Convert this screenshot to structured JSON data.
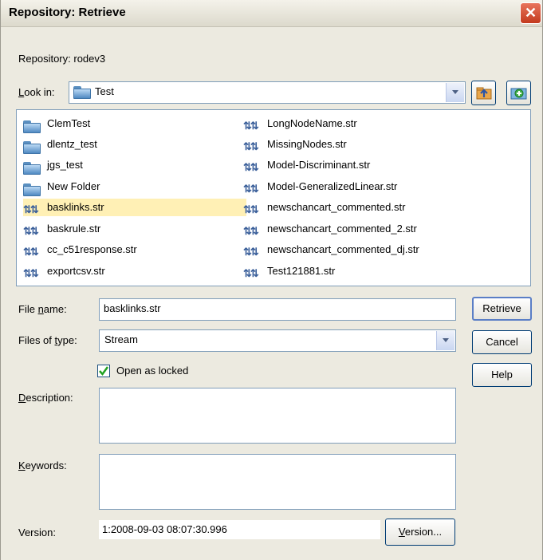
{
  "window": {
    "title": "Repository: Retrieve",
    "close_glyph": "✕"
  },
  "repository_label": "Repository: rodev3",
  "look_in": {
    "label": "Look in:",
    "value": "Test"
  },
  "toolbar": {
    "up_icon": "folder-up-icon",
    "new_folder_icon": "new-folder-icon"
  },
  "files": {
    "column1": [
      {
        "name": "ClemTest",
        "type": "folder"
      },
      {
        "name": "dlentz_test",
        "type": "folder"
      },
      {
        "name": "jgs_test",
        "type": "folder"
      },
      {
        "name": "New Folder",
        "type": "folder"
      },
      {
        "name": "basklinks.str",
        "type": "stream",
        "selected": true
      },
      {
        "name": "baskrule.str",
        "type": "stream"
      },
      {
        "name": "cc_c51response.str",
        "type": "stream"
      },
      {
        "name": "exportcsv.str",
        "type": "stream"
      }
    ],
    "column2": [
      {
        "name": "LongNodeName.str",
        "type": "stream"
      },
      {
        "name": "MissingNodes.str",
        "type": "stream"
      },
      {
        "name": "Model-Discriminant.str",
        "type": "stream"
      },
      {
        "name": "Model-GeneralizedLinear.str",
        "type": "stream"
      },
      {
        "name": "newschancart_commented.str",
        "type": "stream"
      },
      {
        "name": "newschancart_commented_2.str",
        "type": "stream"
      },
      {
        "name": "newschancart_commented_dj.str",
        "type": "stream"
      },
      {
        "name": "Test121881.str",
        "type": "stream"
      }
    ]
  },
  "file_name": {
    "label": "File name:",
    "value": "basklinks.str"
  },
  "files_of_type": {
    "label": "Files of type:",
    "value": "Stream"
  },
  "open_locked": {
    "label": "Open as locked",
    "checked": true
  },
  "description": {
    "label": "Description:",
    "value": ""
  },
  "keywords": {
    "label": "Keywords:",
    "value": ""
  },
  "version": {
    "label": "Version:",
    "value": "1:2008-09-03 08:07:30.996",
    "button": "Version..."
  },
  "buttons": {
    "retrieve": "Retrieve",
    "cancel": "Cancel",
    "help": "Help"
  },
  "colors": {
    "selection": "#fff0b5",
    "border": "#7f9db9",
    "dialog_bg": "#eceae0"
  }
}
